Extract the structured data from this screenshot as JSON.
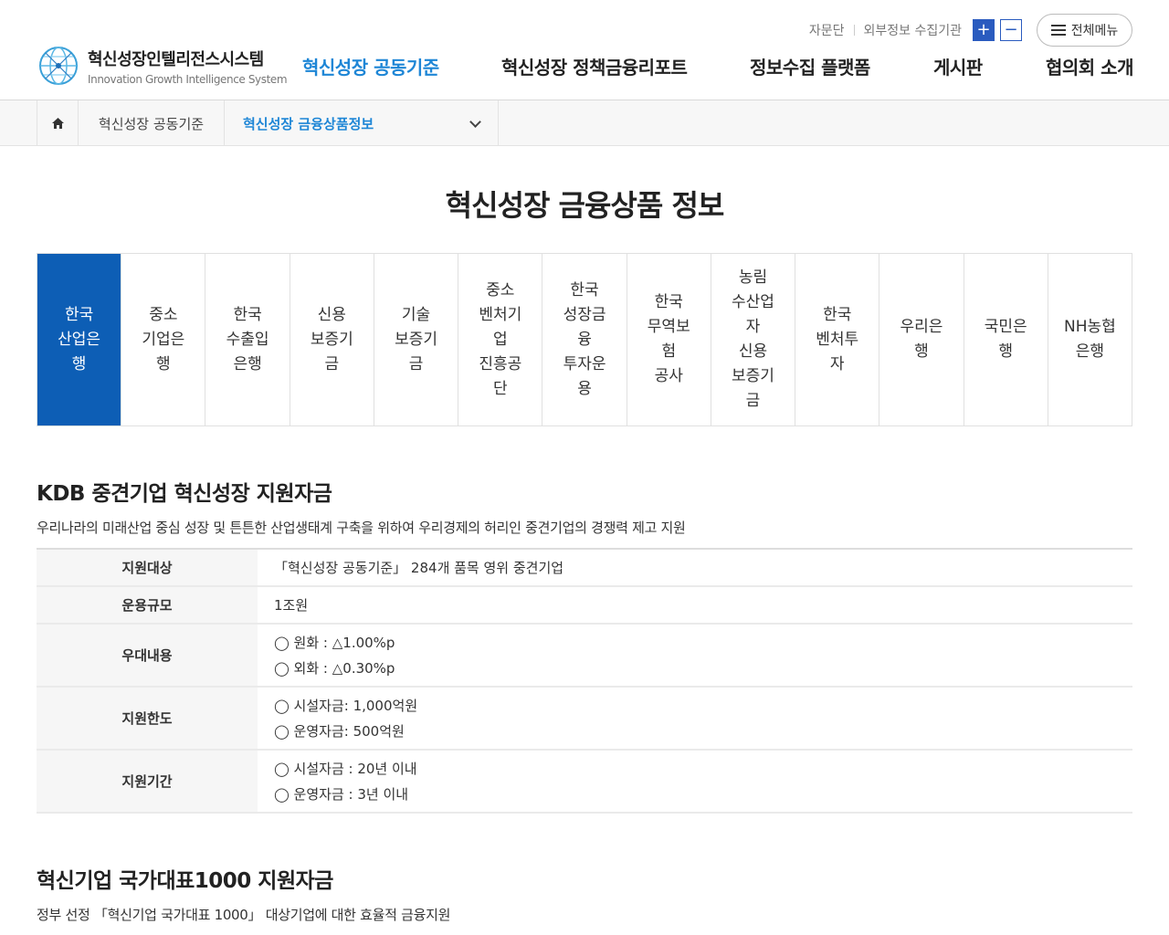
{
  "header": {
    "util_links": [
      "자문단",
      "외부정보 수집기관"
    ],
    "zoom_in": "+",
    "zoom_out": "−",
    "all_menu": "전체메뉴",
    "logo_kr": "혁신성장인텔리전스시스템",
    "logo_en": "Innovation Growth Intelligence System",
    "nav": [
      "혁신성장 공동기준",
      "혁신성장 정책금융리포트",
      "정보수집 플랫폼",
      "게시판",
      "협의회 소개"
    ]
  },
  "breadcrumb": {
    "level1": "혁신성장 공동기준",
    "level2": "혁신성장 금융상품정보"
  },
  "page_title": "혁신성장 금융상품 정보",
  "tabs": [
    "한국\n산업은\n행",
    "중소\n기업은\n행",
    "한국\n수출입\n은행",
    "신용\n보증기\n금",
    "기술\n보증기\n금",
    "중소\n벤처기\n업\n진흥공\n단",
    "한국\n성장금\n융\n투자운\n용",
    "한국\n무역보\n험\n공사",
    "농림\n수산업\n자\n신용\n보증기\n금",
    "한국\n벤처투\n자",
    "우리은\n행",
    "국민은\n행",
    "NH농협\n은행"
  ],
  "section1": {
    "title": "KDB 중견기업 혁신성장 지원자금",
    "desc": "우리나라의 미래산업 중심 성장 및 튼튼한 산업생태계 구축을 위하여 우리경제의 허리인 중견기업의 경쟁력 제고 지원",
    "rows": [
      {
        "label": "지원대상",
        "lines": [
          "「혁신성장 공동기준」 284개 품목 영위 중견기업"
        ]
      },
      {
        "label": "운용규모",
        "lines": [
          "1조원"
        ]
      },
      {
        "label": "우대내용",
        "lines": [
          "◯ 원화 : △1.00%p",
          "◯ 외화 : △0.30%p"
        ]
      },
      {
        "label": "지원한도",
        "lines": [
          "◯ 시설자금: 1,000억원",
          "◯ 운영자금: 500억원"
        ]
      },
      {
        "label": "지원기간",
        "lines": [
          "◯ 시설자금 : 20년 이내",
          "◯ 운영자금 : 3년 이내"
        ]
      }
    ]
  },
  "section2": {
    "title": "혁신기업 국가대표1000 지원자금",
    "desc": "정부 선정 「혁신기업 국가대표 1000」 대상기업에 대한 효율적 금융지원"
  },
  "colors": {
    "accent": "#1e86d6",
    "tab_active": "#0d5eb5",
    "zoom_btn": "#2a5bbf"
  }
}
